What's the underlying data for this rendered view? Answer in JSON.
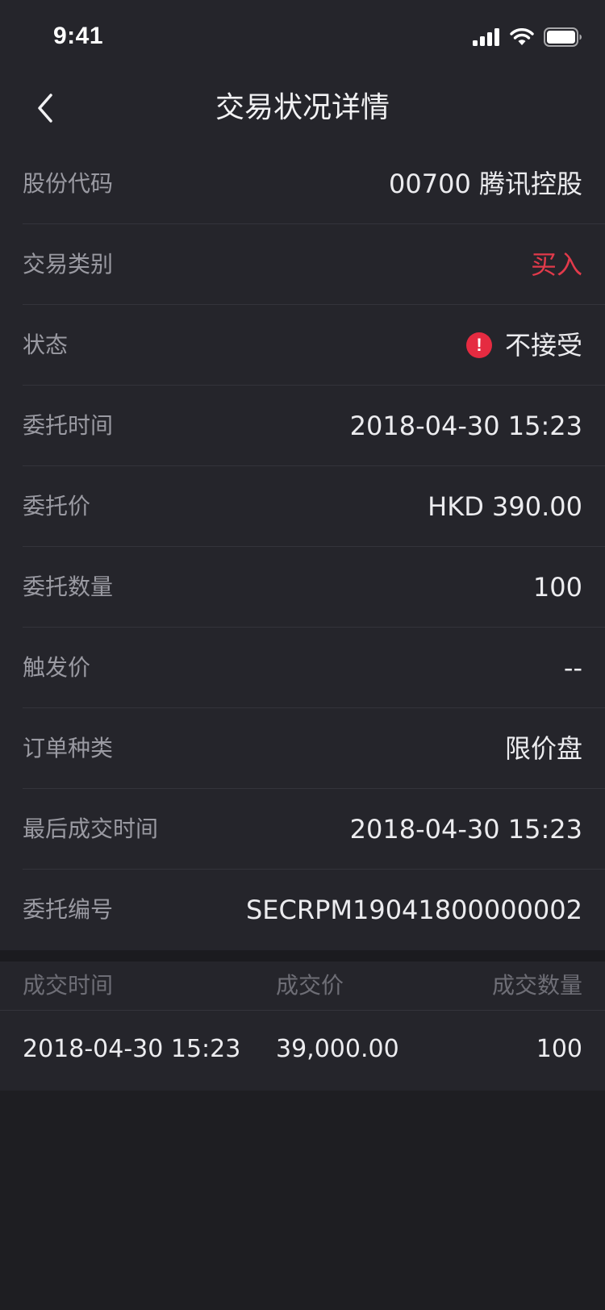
{
  "status_bar": {
    "time": "9:41"
  },
  "nav": {
    "title": "交易状况详情",
    "back_icon": "chevron-left-icon"
  },
  "details": [
    {
      "label": "股份代码",
      "value": "00700 腾讯控股"
    },
    {
      "label": "交易类别",
      "value": "买入",
      "color": "#e23a4b"
    },
    {
      "label": "状态",
      "value": "不接受",
      "icon": "alert-circle-icon"
    },
    {
      "label": "委托时间",
      "value": "2018-04-30 15:23"
    },
    {
      "label": "委托价",
      "value": "HKD 390.00"
    },
    {
      "label": "委托数量",
      "value": "100"
    },
    {
      "label": "触发价",
      "value": "--"
    },
    {
      "label": "订单种类",
      "value": "限价盘"
    },
    {
      "label": "最后成交时间",
      "value": "2018-04-30 15:23"
    },
    {
      "label": "委托编号",
      "value": "SECRPM19041800000002"
    }
  ],
  "fills": {
    "headers": [
      "成交时间",
      "成交价",
      "成交数量"
    ],
    "rows": [
      [
        "2018-04-30 15:23",
        "39,000.00",
        "100"
      ]
    ]
  },
  "colors": {
    "background": "#1e1e22",
    "surface": "#25252b",
    "buy_red": "#e23a4b",
    "alert_red": "#e52b41"
  }
}
